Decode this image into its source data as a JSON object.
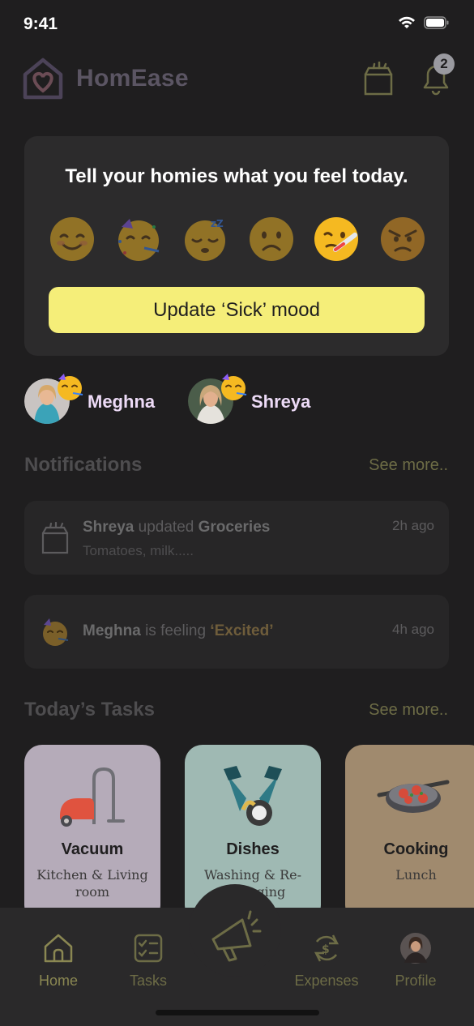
{
  "status_bar": {
    "time": "9:41",
    "icons": [
      "wifi-icon",
      "battery-icon"
    ]
  },
  "header": {
    "brand": "HomEase",
    "logo_icon": "house-heart-icon",
    "grocery_icon": "grocery-bag-icon",
    "bell_icon": "bell-icon",
    "notification_count": "2"
  },
  "mood": {
    "title": "Tell your homies what you feel today.",
    "emojis": [
      {
        "name": "happy",
        "icon": "smiling-face-icon"
      },
      {
        "name": "excited",
        "icon": "partying-face-icon"
      },
      {
        "name": "sleepy",
        "icon": "sleeping-face-icon"
      },
      {
        "name": "sad",
        "icon": "frowning-face-icon"
      },
      {
        "name": "sick",
        "icon": "thermometer-face-icon",
        "selected": true
      },
      {
        "name": "angry",
        "icon": "angry-face-icon"
      }
    ],
    "button_label": "Update ‘Sick’ mood"
  },
  "homies": [
    {
      "name": "Meghna",
      "mood_icon": "partying-face-icon"
    },
    {
      "name": "Shreya",
      "mood_icon": "partying-face-icon"
    }
  ],
  "notifications": {
    "title": "Notifications",
    "see_more": "See more..",
    "items": [
      {
        "icon": "grocery-bag-icon",
        "actor": "Shreya",
        "verb": "updated",
        "object": "Groceries",
        "detail": "Tomatoes, milk.....",
        "time": "2h ago"
      },
      {
        "icon": "partying-face-icon",
        "actor": "Meghna",
        "verb": "is feeling",
        "object": "‘Excited’",
        "time": "4h ago"
      }
    ]
  },
  "tasks": {
    "title": "Today’s Tasks",
    "see_more": "See more..",
    "items": [
      {
        "title": "Vacuum",
        "subtitle": "Kitchen & Living room",
        "icon": "vacuum-icon",
        "color": "#b5abb9"
      },
      {
        "title": "Dishes",
        "subtitle": "Washing & Re-arranging",
        "icon": "dishes-icon",
        "color": "#9fb9b3"
      },
      {
        "title": "Cooking",
        "subtitle": "Lunch",
        "icon": "cooking-pan-icon",
        "color": "#a08a6e"
      }
    ]
  },
  "bottom_nav": {
    "items": [
      {
        "label": "Home",
        "icon": "home-icon",
        "active": true
      },
      {
        "label": "Tasks",
        "icon": "checklist-icon"
      },
      {
        "label": "Expenses",
        "icon": "money-cycle-icon"
      },
      {
        "label": "Profile",
        "icon": "avatar-icon"
      }
    ],
    "fab_icon": "megaphone-icon"
  },
  "colors": {
    "background": "#1f1e1f",
    "card": "#2c2b2c",
    "accent_yellow": "#f5ee79",
    "muted_olive": "#6d6c46",
    "homie_name": "#eddbf7"
  }
}
